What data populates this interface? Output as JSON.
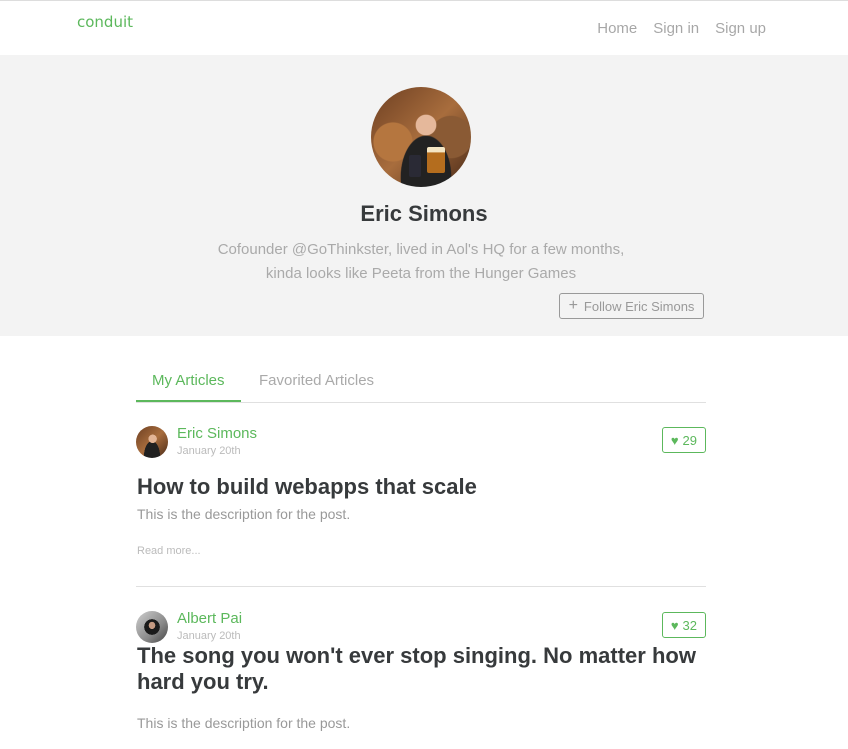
{
  "navbar": {
    "brand": "conduit",
    "links": [
      "Home",
      "Sign in",
      "Sign up"
    ]
  },
  "profile": {
    "name": "Eric Simons",
    "bio": "Cofounder @GoThinkster, lived in Aol's HQ for a few months, kinda looks like Peeta from the Hunger Games",
    "follow_label": "Follow Eric Simons",
    "follow_icon": "plus-icon"
  },
  "tabs": [
    {
      "label": "My Articles",
      "active": true
    },
    {
      "label": "Favorited Articles",
      "active": false
    }
  ],
  "articles": [
    {
      "author": "Eric Simons",
      "date": "January 20th",
      "likes": "29",
      "title": "How to build webapps that scale",
      "description": "This is the description for the post.",
      "read_more": "Read more..."
    },
    {
      "author": "Albert Pai",
      "date": "January 20th",
      "likes": "32",
      "title": "The song you won't ever stop singing. No matter how hard you try.",
      "description": "This is the description for the post."
    }
  ],
  "colors": {
    "accent": "#5cb85c",
    "banner_bg": "#f3f3f3",
    "muted_text": "#aaaaaa"
  }
}
